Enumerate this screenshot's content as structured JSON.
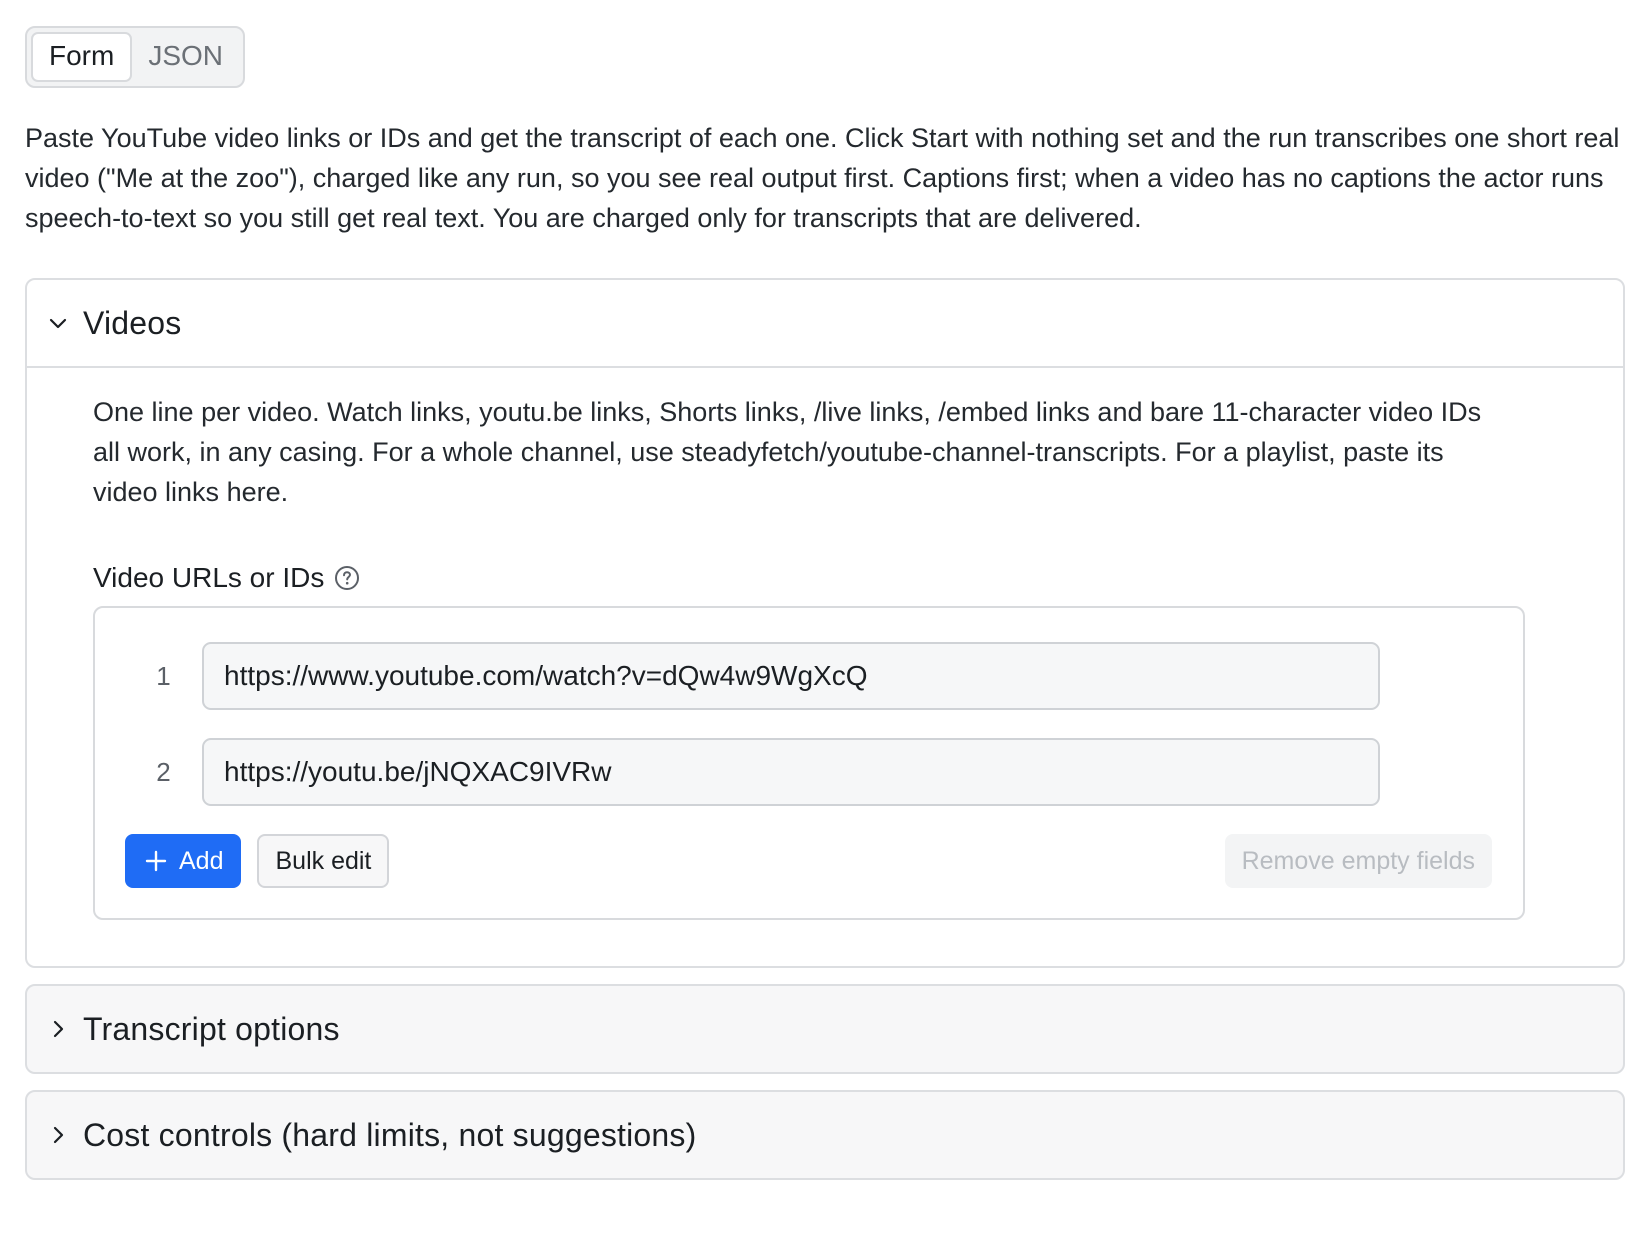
{
  "mode_switch": {
    "tabs": [
      {
        "label": "Form",
        "active": true
      },
      {
        "label": "JSON",
        "active": false
      }
    ]
  },
  "intro_text": "Paste YouTube video links or IDs and get the transcript of each one. Click Start with nothing set and the run transcribes one short real video (\"Me at the zoo\"), charged like any run, so you see real output first. Captions first; when a video has no captions the actor runs speech-to-text so you still get real text. You are charged only for transcripts that are delivered.",
  "sections": {
    "videos": {
      "title": "Videos",
      "expanded": true,
      "icon": "chevron-down-icon",
      "description": "One line per video. Watch links, youtu.be links, Shorts links, /live links, /embed links and bare 11-character video IDs all work, in any casing. For a whole channel, use steadyfetch/youtube-channel-transcripts. For a playlist, paste its video links here.",
      "field": {
        "label": "Video URLs or IDs",
        "help_icon": "question-circle-icon",
        "rows": [
          {
            "num": "1",
            "value": "https://www.youtube.com/watch?v=dQw4w9WgXcQ"
          },
          {
            "num": "2",
            "value": "https://youtu.be/jNQXAC9IVRw"
          }
        ],
        "add_label": "Add",
        "bulk_edit_label": "Bulk edit",
        "remove_empty_label": "Remove empty fields"
      }
    },
    "transcript_options": {
      "title": "Transcript options",
      "expanded": false,
      "icon": "chevron-right-icon"
    },
    "cost_controls": {
      "title": "Cost controls (hard limits, not suggestions)",
      "expanded": false,
      "icon": "chevron-right-icon"
    }
  },
  "colors": {
    "accent": "#1f6cf5",
    "border": "#dcdee1",
    "text": "#1b1f23",
    "muted": "#6b7076",
    "disabled_text": "#b8bcc1"
  }
}
